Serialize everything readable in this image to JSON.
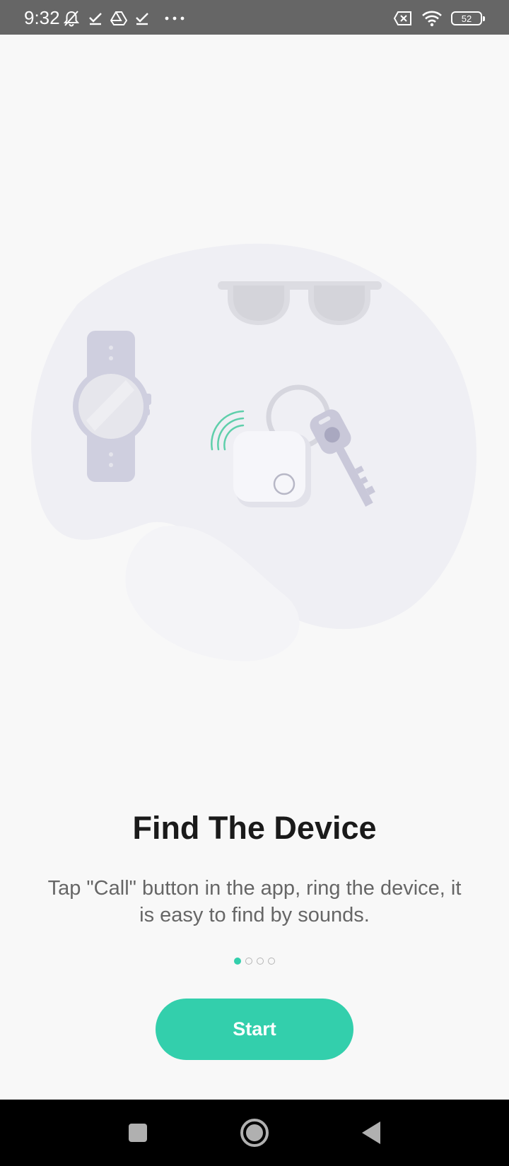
{
  "status_bar": {
    "time": "9:32",
    "battery_level": "52",
    "left_icons": [
      "notifications-off-icon",
      "check-icon",
      "drive-icon",
      "check-icon",
      "more-icon"
    ],
    "right_icons": [
      "sim-disabled-icon",
      "wifi-icon",
      "battery-icon"
    ]
  },
  "illustration": {
    "items": [
      "watch",
      "sunglasses",
      "tracker-tag",
      "key",
      "key-ring",
      "sound-waves"
    ],
    "colors": {
      "blob": "#eeeef3",
      "object": "#cfcfdf",
      "waves": "#5fcfab"
    }
  },
  "onboarding": {
    "title": "Find The Device",
    "description": "Tap \"Call\" button in the app, ring the device, it is easy to find by sounds.",
    "page_count": 4,
    "current_page": 1
  },
  "start_button": {
    "label": "Start"
  },
  "nav_bar": {
    "buttons": [
      "recents-button",
      "home-button",
      "back-button"
    ]
  },
  "colors": {
    "accent": "#33cfac",
    "background": "#f8f8f8",
    "title": "#1a1a1a",
    "description": "#666666",
    "status_bar": "#666666",
    "nav_bar": "#000000"
  }
}
